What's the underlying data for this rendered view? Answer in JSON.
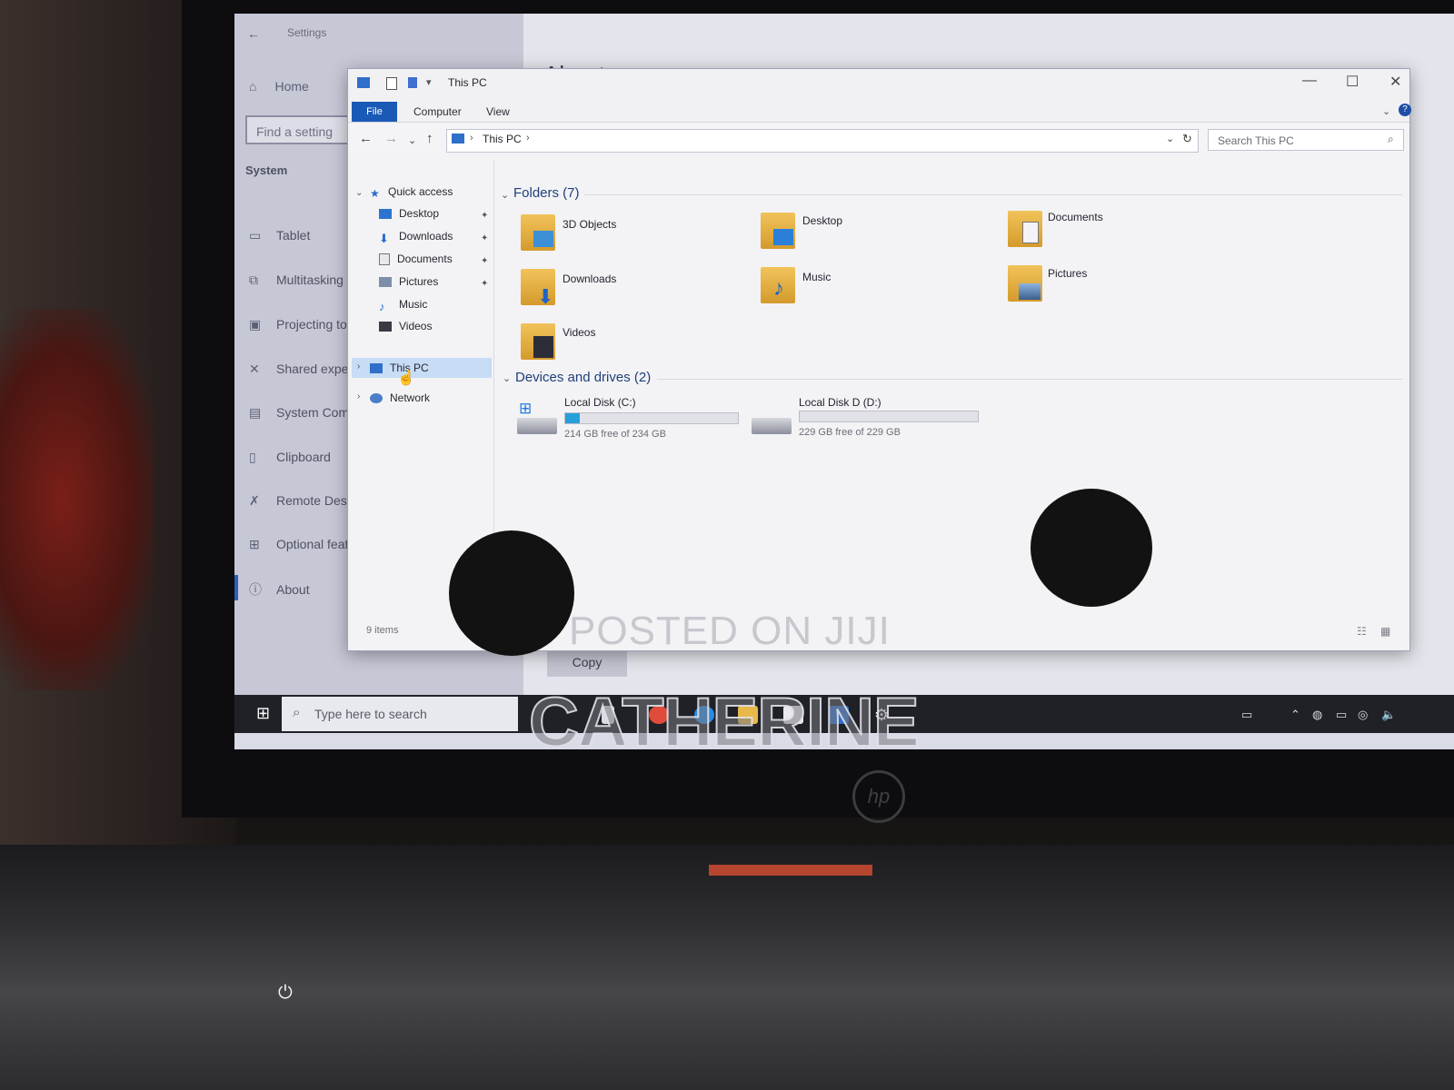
{
  "settings": {
    "window_title": "Settings",
    "home": "Home",
    "find_placeholder": "Find a setting",
    "section": "System",
    "items": [
      "Tablet",
      "Multitasking",
      "Projecting to",
      "Shared exper",
      "System Comp",
      "Clipboard",
      "Remote Desk",
      "Optional feat",
      "About"
    ],
    "page_heading": "About",
    "copy_button": "Copy"
  },
  "explorer": {
    "title": "This PC",
    "ribbon_tabs": [
      "File",
      "Computer",
      "View"
    ],
    "address": "This PC",
    "search_placeholder": "Search This PC",
    "nav": {
      "quick_access": "Quick access",
      "items": [
        "Desktop",
        "Downloads",
        "Documents",
        "Pictures",
        "Music",
        "Videos"
      ],
      "this_pc": "This PC",
      "network": "Network"
    },
    "folders_header": "Folders (7)",
    "folders": [
      "3D Objects",
      "Desktop",
      "Documents",
      "Downloads",
      "Music",
      "Pictures",
      "Videos"
    ],
    "devices_header": "Devices and drives (2)",
    "drives": [
      {
        "name": "Local Disk (C:)",
        "free": "214 GB free of 234 GB",
        "used_fraction": 0.085
      },
      {
        "name": "Local Disk D (D:)",
        "free": "229 GB free of 229 GB",
        "used_fraction": 0.0
      }
    ],
    "status": "9 items"
  },
  "taskbar": {
    "search_placeholder": "Type here to search"
  },
  "watermark": {
    "line1": "POSTED ON JIJI",
    "line2": "CATHERINE"
  },
  "brand": "hp",
  "colors": {
    "accent": "#1a5ab6",
    "selection": "#c7dcf5",
    "drive_bar": "#26a0da"
  }
}
